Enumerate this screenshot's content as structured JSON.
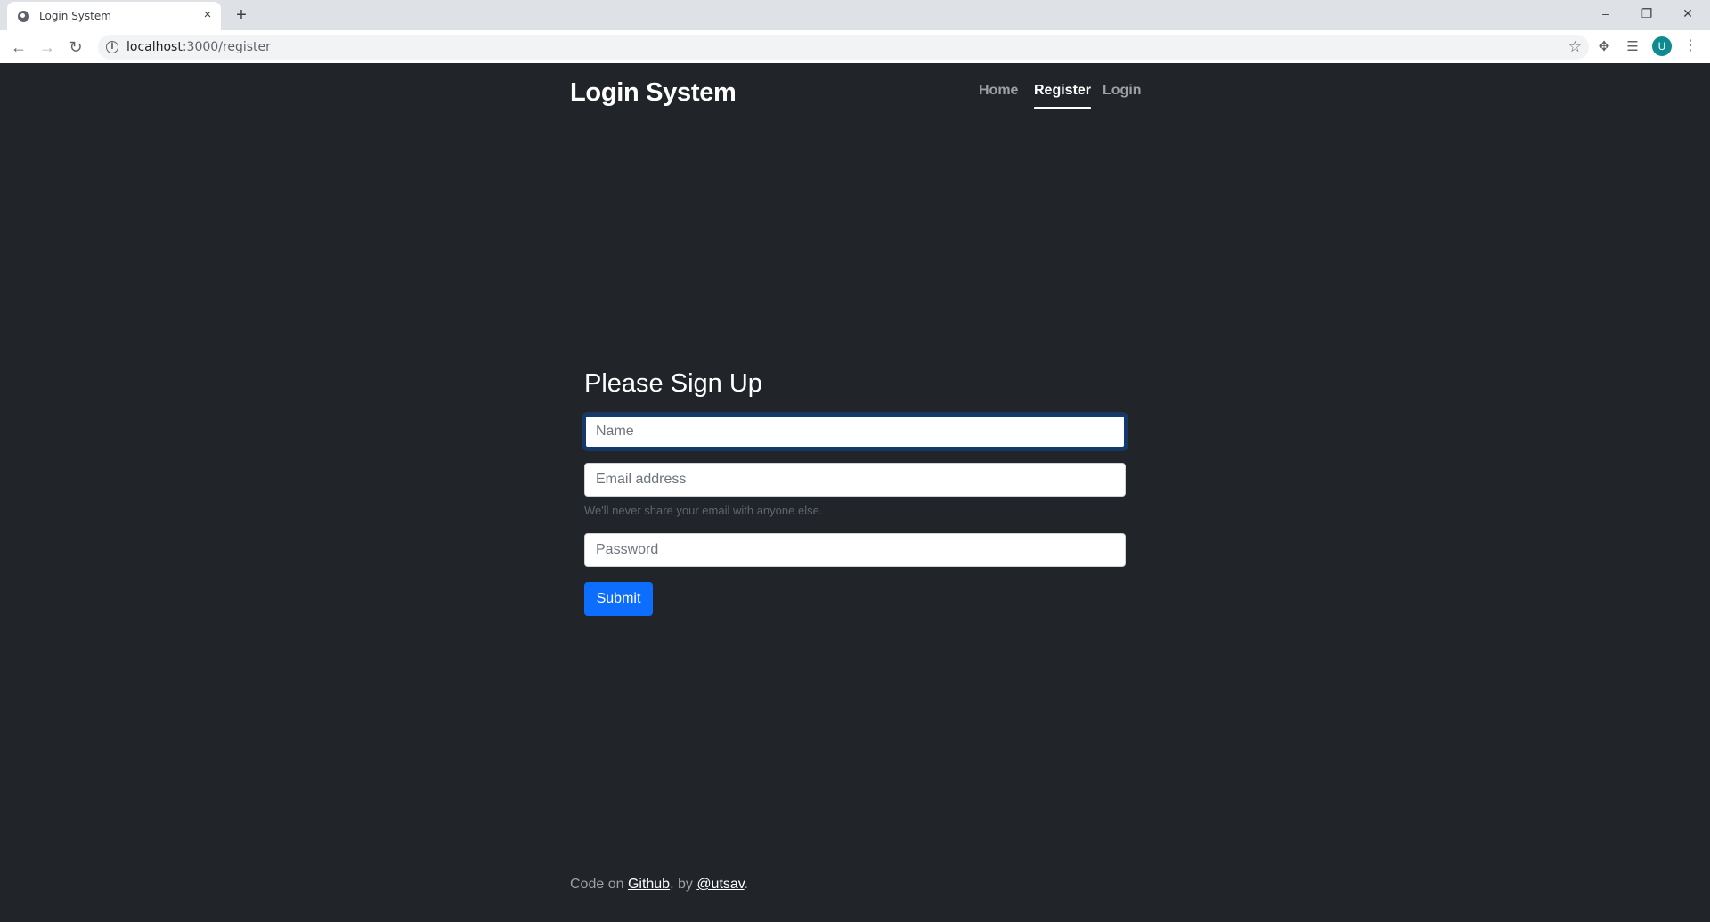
{
  "browser": {
    "tab_title": "Login System",
    "tab_close": "×",
    "new_tab": "+",
    "url_host": "localhost",
    "url_rest": ":3000/register",
    "info_glyph": "i",
    "back_glyph": "←",
    "forward_glyph": "→",
    "reload_glyph": "↻",
    "star_glyph": "☆",
    "avatar_letter": "U",
    "menu_glyph": "⋮",
    "window_minimize": "–",
    "window_restore": "❐",
    "window_close": "✕",
    "extensions_glyph": "✥",
    "media_glyph": "☰"
  },
  "navbar": {
    "brand": "Login System",
    "links": [
      {
        "label": "Home",
        "active": false
      },
      {
        "label": "Register",
        "active": true
      },
      {
        "label": "Login",
        "active": false
      }
    ]
  },
  "form": {
    "title": "Please Sign Up",
    "name_placeholder": "Name",
    "name_value": "",
    "email_placeholder": "Email address",
    "email_value": "",
    "email_help": "We'll never share your email with anyone else.",
    "password_placeholder": "Password",
    "password_value": "",
    "submit_label": "Submit"
  },
  "footer": {
    "prefix": "Code on ",
    "github_link": "Github",
    "middle": ", by ",
    "author_link": "@utsav",
    "suffix": "."
  },
  "colors": {
    "page_background": "#212529",
    "primary_button": "#0d6efd",
    "avatar": "#0f8a8e"
  }
}
